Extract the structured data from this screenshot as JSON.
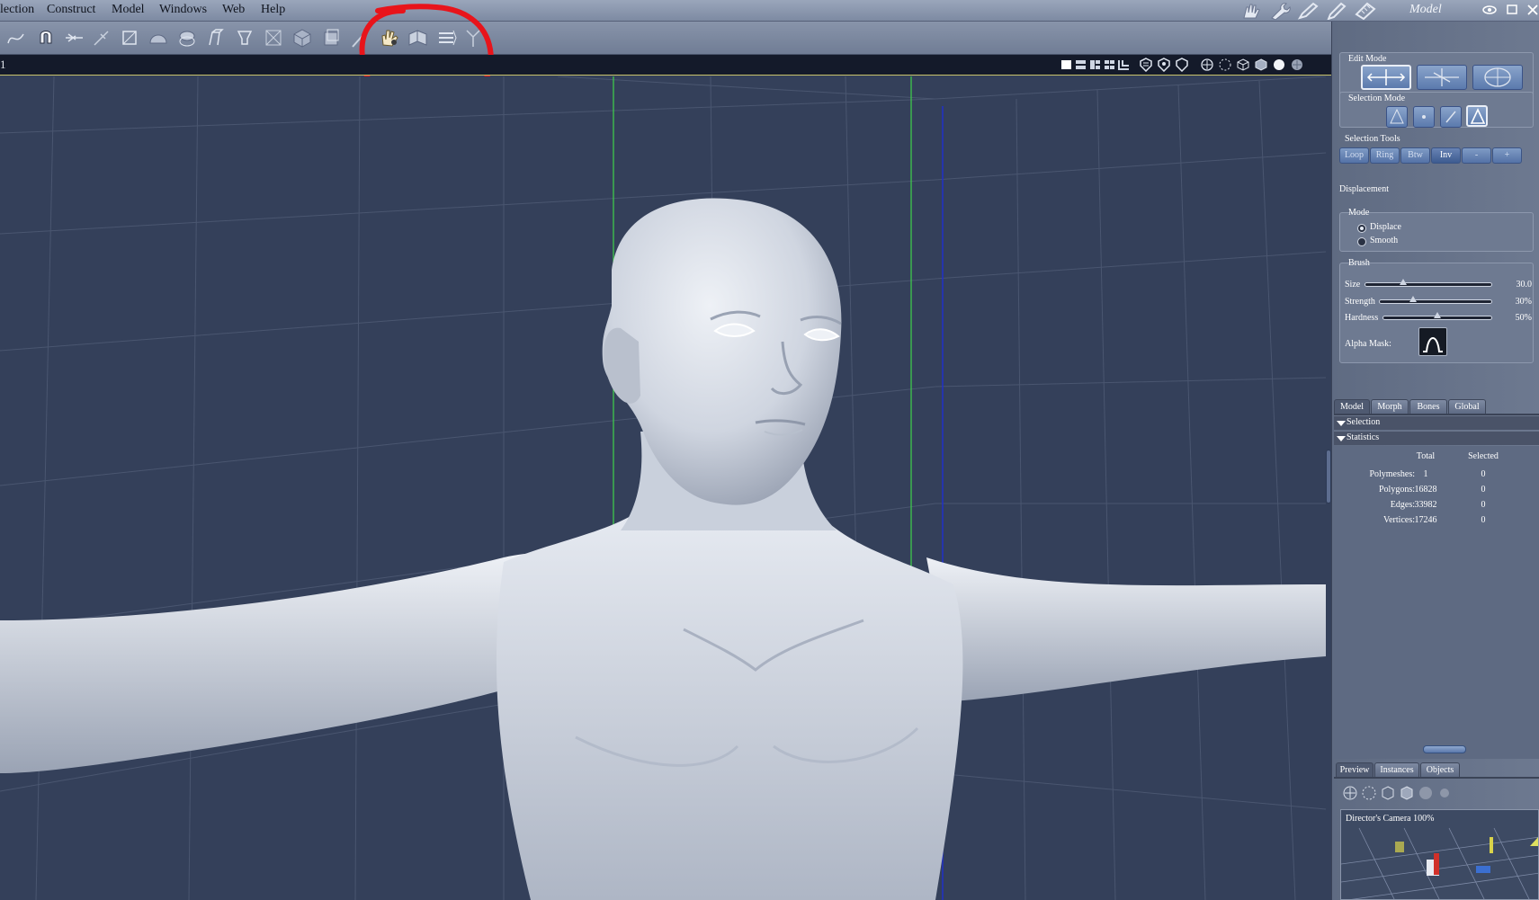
{
  "menu": {
    "items": [
      "lection",
      "Construct",
      "Model",
      "Windows",
      "Web",
      "Help"
    ],
    "room_label": "Model"
  },
  "room_tabs": [
    "hand-icon",
    "wrench-icon",
    "brush-icon",
    "pencil-icon",
    "ruler-icon"
  ],
  "window_controls": [
    "eye-icon",
    "maximize-icon",
    "close-icon"
  ],
  "toolbar": {
    "tools": [
      "curve-tool-icon",
      "magnet-tool-icon",
      "knife-tool-icon",
      "weld-tool-icon",
      "transform-box-icon",
      "dome-icon",
      "extrude-icon",
      "bridge-icon",
      "bevel-icon",
      "inset-icon",
      "cube-icon",
      "shell-icon",
      "brush-tool-icon",
      "sculpt-hand-icon",
      "fold-icon",
      "stack-icon",
      "pin-icon"
    ],
    "highlighted_tool": "sculpt-hand-icon",
    "annotation_color": "#e8141b"
  },
  "viewport": {
    "corner_text": "1",
    "header_icons": [
      "single-view-icon",
      "two-view-icon",
      "three-view-icon",
      "four-view-icon",
      "layout-icon",
      "shield-a-icon",
      "shield-b-icon",
      "shield-c-icon",
      "camera-orbit-icon",
      "camera-rotate-icon",
      "wireframe-icon",
      "flat-shade-icon",
      "smooth-shade-icon",
      "texture-shade-icon"
    ]
  },
  "panel": {
    "edit_mode": {
      "label": "Edit Mode",
      "buttons": [
        "move-mode-icon",
        "axis-mode-icon",
        "sphere-mode-icon"
      ],
      "active": 0
    },
    "selection_mode": {
      "label": "Selection Mode",
      "buttons": [
        "polygon-select-icon",
        "vertex-select-icon",
        "edge-select-icon",
        "face-select-icon"
      ],
      "active": 3
    },
    "selection_tools": {
      "label": "Selection Tools",
      "buttons": [
        "Loop",
        "Ring",
        "Btw",
        "Inv",
        "-",
        "+"
      ],
      "active": 3
    },
    "displacement": {
      "label": "Displacement"
    },
    "mode": {
      "label": "Mode",
      "options": [
        "Displace",
        "Smooth"
      ],
      "selected": 0
    },
    "brush": {
      "label": "Brush",
      "size": {
        "label": "Size",
        "value": "30.0",
        "fraction": 0.3
      },
      "strength": {
        "label": "Strength",
        "value": "30%",
        "fraction": 0.3
      },
      "hardness": {
        "label": "Hardness",
        "value": "50%",
        "fraction": 0.5
      },
      "alpha_mask_label": "Alpha Mask:"
    },
    "tabs": [
      "Model",
      "Morph",
      "Bones",
      "Global"
    ],
    "active_tab": 0,
    "sections": {
      "selection": "Selection",
      "statistics": "Statistics"
    },
    "statistics": {
      "col_total": "Total",
      "col_selected": "Selected",
      "rows": [
        {
          "label": "Polymeshes:",
          "total": "1",
          "selected": "0"
        },
        {
          "label": "Polygons:",
          "total": "16828",
          "selected": "0"
        },
        {
          "label": "Edges:",
          "total": "33982",
          "selected": "0"
        },
        {
          "label": "Vertices:",
          "total": "17246",
          "selected": "0"
        }
      ]
    },
    "bottom_tabs": [
      "Preview",
      "Instances",
      "Objects"
    ],
    "preview_icons": [
      "orbit-icon",
      "rotate-icon",
      "wire-cube-icon",
      "solid-cube-icon",
      "sphere-icon",
      "textured-sphere-icon"
    ],
    "preview_title": "Director's Camera 100%"
  }
}
